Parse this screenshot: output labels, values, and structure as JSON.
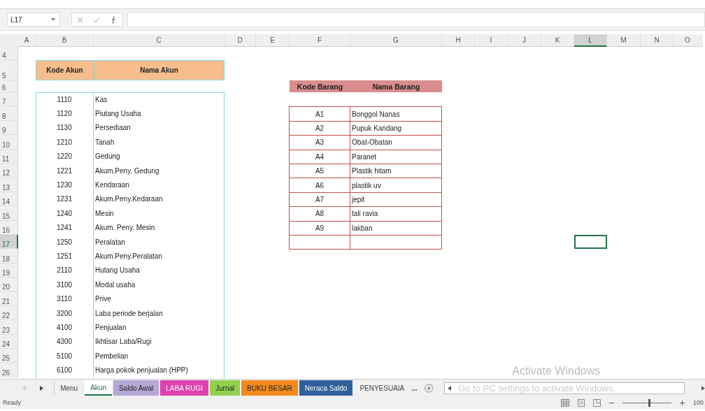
{
  "formula_bar": {
    "name_box": "L17"
  },
  "columns": [
    {
      "label": "A",
      "selected": false
    },
    {
      "label": "B",
      "selected": false
    },
    {
      "label": "C",
      "selected": false
    },
    {
      "label": "D",
      "selected": false
    },
    {
      "label": "E",
      "selected": false
    },
    {
      "label": "F",
      "selected": false
    },
    {
      "label": "G",
      "selected": false
    },
    {
      "label": "H",
      "selected": false
    },
    {
      "label": "I",
      "selected": false
    },
    {
      "label": "J",
      "selected": false
    },
    {
      "label": "K",
      "selected": false
    },
    {
      "label": "L",
      "selected": true
    },
    {
      "label": "M",
      "selected": false
    },
    {
      "label": "N",
      "selected": false
    },
    {
      "label": "O",
      "selected": false
    }
  ],
  "rows": [
    {
      "label": "4",
      "selected": false
    },
    {
      "label": "5",
      "selected": false
    },
    {
      "label": "6",
      "selected": false
    },
    {
      "label": "7",
      "selected": false
    },
    {
      "label": "8",
      "selected": false
    },
    {
      "label": "9",
      "selected": false
    },
    {
      "label": "10",
      "selected": false
    },
    {
      "label": "11",
      "selected": false
    },
    {
      "label": "12",
      "selected": false
    },
    {
      "label": "13",
      "selected": false
    },
    {
      "label": "14",
      "selected": false
    },
    {
      "label": "15",
      "selected": false
    },
    {
      "label": "16",
      "selected": false
    },
    {
      "label": "17",
      "selected": true
    },
    {
      "label": "18",
      "selected": false
    },
    {
      "label": "19",
      "selected": false
    },
    {
      "label": "20",
      "selected": false
    },
    {
      "label": "21",
      "selected": false
    },
    {
      "label": "22",
      "selected": false
    },
    {
      "label": "23",
      "selected": false
    },
    {
      "label": "24",
      "selected": false
    },
    {
      "label": "25",
      "selected": false
    },
    {
      "label": "26",
      "selected": false
    }
  ],
  "akun_table": {
    "headers": [
      "Kode Akun",
      "Nama Akun"
    ],
    "rows": [
      [
        "1110",
        "Kas"
      ],
      [
        "1120",
        "Piutang Usaha"
      ],
      [
        "1130",
        "Persediaan"
      ],
      [
        "1210",
        "Tanah"
      ],
      [
        "1220",
        "Gedung"
      ],
      [
        "1221",
        "Akum.Peny. Gedung"
      ],
      [
        "1230",
        "Kendaraan"
      ],
      [
        "1231",
        "Akum.Peny.Kedaraan"
      ],
      [
        "1240",
        "Mesin"
      ],
      [
        "1241",
        "Akum. Peny. Mesin"
      ],
      [
        "1250",
        "Peralatan"
      ],
      [
        "1251",
        "Akum.Peny.Peralatan"
      ],
      [
        "2110",
        "Hutang Usaha"
      ],
      [
        "3100",
        "Modal usaha"
      ],
      [
        "3110",
        "Prive"
      ],
      [
        "3200",
        "Laba periode berjalan"
      ],
      [
        "4100",
        "Penjualan"
      ],
      [
        "4300",
        "Ikhtisar Laba/Rugi"
      ],
      [
        "5100",
        "Pembelian"
      ],
      [
        "6100",
        "Harga pokok penjualan (HPP)"
      ]
    ]
  },
  "barang_table": {
    "headers": [
      "Kode Barang",
      "Nama Barang"
    ],
    "rows": [
      [
        "A1",
        "Bonggol Nanas"
      ],
      [
        "A2",
        "Pupuk Kandang"
      ],
      [
        "A3",
        "Obat-Obatan"
      ],
      [
        "A4",
        "Paranet"
      ],
      [
        "A5",
        "Plastik hitam"
      ],
      [
        "A6",
        "plastik uv"
      ],
      [
        "A7",
        "jepit"
      ],
      [
        "A8",
        "tali ravia"
      ],
      [
        "A9",
        "lakban"
      ]
    ]
  },
  "sheet_tabs": [
    {
      "label": "Menu",
      "selected": false
    },
    {
      "label": "Akun",
      "selected": true
    },
    {
      "label": "Saldo Awal",
      "selected": false,
      "color": "#b4a7d6"
    },
    {
      "label": "LABA RUGI",
      "selected": false,
      "color": "#e040b0"
    },
    {
      "label": "Jurnal",
      "selected": false,
      "color": "#8fd14f"
    },
    {
      "label": "BUKU BESAR",
      "selected": false,
      "color": "#f28a1c"
    },
    {
      "label": "Neraca Saldo",
      "selected": false,
      "color": "#2f5f9a"
    },
    {
      "label": "PENYESUAIA",
      "selected": false
    }
  ],
  "more_tabs": "...",
  "activation_notice": {
    "title": "Activate Windows",
    "text": "Go to PC settings to activate Windows."
  },
  "status_bar": {
    "status": "Ready",
    "level": 0.55,
    "zoom": "100"
  }
}
